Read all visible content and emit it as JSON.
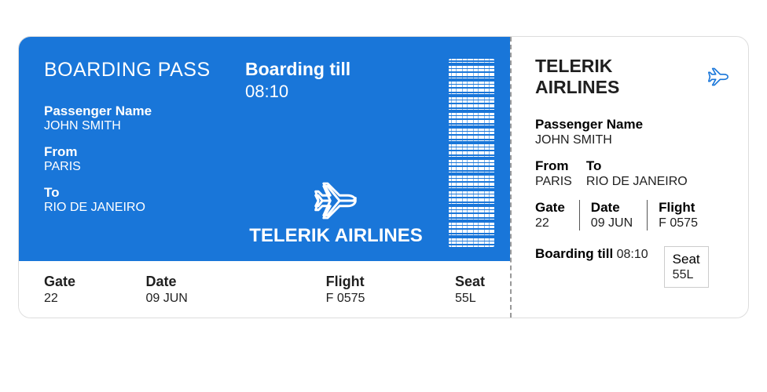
{
  "main": {
    "title": "BOARDING PASS",
    "passenger_label": "Passenger Name",
    "passenger_value": "JOHN SMITH",
    "from_label": "From",
    "from_value": "PARIS",
    "to_label": "To",
    "to_value": "RIO DE JANEIRO",
    "boarding_till_label": "Boarding till",
    "boarding_till_value": "08:10",
    "airline_name": "TELERIK AIRLINES"
  },
  "bottom": {
    "gate_label": "Gate",
    "gate_value": "22",
    "date_label": "Date",
    "date_value": "09 JUN",
    "flight_label": "Flight",
    "flight_value": "F 0575",
    "seat_label": "Seat",
    "seat_value": "55L"
  },
  "stub": {
    "airline_name": "TELERIK AIRLINES",
    "passenger_label": "Passenger Name",
    "passenger_value": "JOHN SMITH",
    "from_label": "From",
    "from_value": "PARIS",
    "to_label": "To",
    "to_value": "RIO DE JANEIRO",
    "gate_label": "Gate",
    "gate_value": "22",
    "date_label": "Date",
    "date_value": "09 JUN",
    "flight_label": "Flight",
    "flight_value": "F 0575",
    "boarding_till_label": "Boarding till",
    "boarding_till_value": "08:10",
    "seat_label": "Seat",
    "seat_value": "55L"
  },
  "colors": {
    "accent": "#1976d9"
  }
}
